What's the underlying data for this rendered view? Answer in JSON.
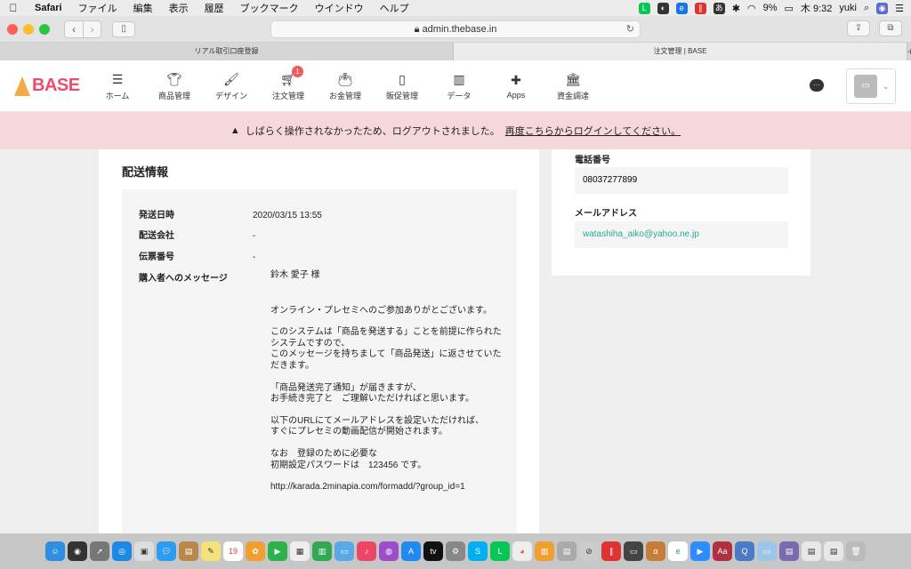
{
  "menubar": {
    "app": "Safari",
    "items": [
      "ファイル",
      "編集",
      "表示",
      "履歴",
      "ブックマーク",
      "ウインドウ",
      "ヘルプ"
    ],
    "battery": "9%",
    "clock": "木 9:32",
    "user": "yuki"
  },
  "browser": {
    "url": "admin.thebase.in",
    "tabs": [
      {
        "title": "リアル取引口座登録",
        "active": false
      },
      {
        "title": "注文管理 | BASE",
        "active": true
      }
    ]
  },
  "appnav": {
    "logo": "BASE",
    "items": [
      {
        "label": "ホーム",
        "icon": "list-icon"
      },
      {
        "label": "商品管理",
        "icon": "shirt-icon"
      },
      {
        "label": "デザイン",
        "icon": "brush-icon"
      },
      {
        "label": "注文管理",
        "icon": "cart-icon",
        "badge": "1"
      },
      {
        "label": "お金管理",
        "icon": "wallet-icon"
      },
      {
        "label": "販促管理",
        "icon": "phone-icon"
      },
      {
        "label": "データ",
        "icon": "chart-icon"
      },
      {
        "label": "Apps",
        "icon": "puzzle-icon"
      },
      {
        "label": "資金調達",
        "icon": "bank-icon"
      }
    ]
  },
  "alert": {
    "text": "しばらく操作されなかったため、ログアウトされました。",
    "link": "再度こちらからログインしてください。"
  },
  "shipping": {
    "title": "配送情報",
    "rows": [
      {
        "label": "発送日時",
        "value": "2020/03/15 13:55"
      },
      {
        "label": "配送会社",
        "value": "-"
      },
      {
        "label": "伝票番号",
        "value": "-"
      }
    ],
    "message_label": "購入者へのメッセージ",
    "message_paragraphs": [
      "鈴木 愛子 様",
      "オンライン・プレセミへのご参加ありがとございます。",
      "このシステムは「商品を発送する」ことを前提に作られたシステムですので、\nこのメッセージを持ちまして「商品発送」に返させていただきます。",
      "「商品発送完了通知」が届きますが、\nお手続き完了と　ご理解いただければと思います。",
      "以下のURLにてメールアドレスを設定いただければ、\nすぐにプレセミの動画配信が開始されます。",
      "なお　登録のために必要な\n初期設定パスワードは　123456 です。",
      "http://karada.2minapia.com/formadd/?group_id=1"
    ]
  },
  "contact": {
    "phone_label": "電話番号",
    "phone": "08037277899",
    "email_label": "メールアドレス",
    "email": "watashiha_aiko@yahoo.ne.jp",
    "email_color": "#2aa89a"
  }
}
